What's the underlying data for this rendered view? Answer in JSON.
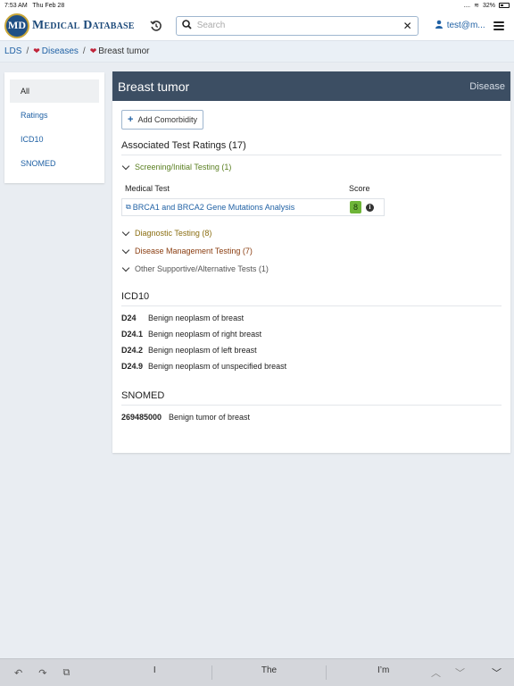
{
  "status_bar": {
    "time": "7:53 AM",
    "date": "Thu Feb 28",
    "signal": "....",
    "battery": "32%"
  },
  "navbar": {
    "logo_badge": "MD",
    "logo_text": "Medical Database",
    "search_placeholder": "Search",
    "user_label": "test@m..."
  },
  "breadcrumb": {
    "root": "LDS",
    "parent": "Diseases",
    "current": "Breast tumor"
  },
  "sidebar": {
    "items": [
      {
        "label": "All"
      },
      {
        "label": "Ratings"
      },
      {
        "label": "ICD10"
      },
      {
        "label": "SNOMED"
      }
    ]
  },
  "main": {
    "title": "Breast tumor",
    "type": "Disease",
    "add_button": "Add Comorbidity",
    "ratings_title": "Associated Test Ratings (17)",
    "groups": [
      {
        "label": "Screening/Initial Testing (1)",
        "color": "#5a7f20"
      },
      {
        "label": "Diagnostic Testing (8)",
        "color": "#8a6d10"
      },
      {
        "label": "Disease Management Testing (7)",
        "color": "#8a3d10"
      },
      {
        "label": "Other Supportive/Alternative Tests (1)",
        "color": "#555555"
      }
    ],
    "table": {
      "col_test": "Medical Test",
      "col_score": "Score",
      "rows": [
        {
          "test": "BRCA1 and BRCA2 Gene Mutations Analysis",
          "score": "8"
        }
      ]
    },
    "icd10": {
      "title": "ICD10",
      "codes": [
        {
          "code": "D24",
          "desc": "Benign neoplasm of breast"
        },
        {
          "code": "D24.1",
          "desc": "Benign neoplasm of right breast"
        },
        {
          "code": "D24.2",
          "desc": "Benign neoplasm of left breast"
        },
        {
          "code": "D24.9",
          "desc": "Benign neoplasm of unspecified breast"
        }
      ]
    },
    "snomed": {
      "title": "SNOMED",
      "codes": [
        {
          "code": "269485000",
          "desc": "Benign tumor of breast"
        }
      ]
    }
  },
  "keyboard": {
    "suggestions": [
      "I",
      "The",
      "I’m"
    ]
  },
  "colors": {
    "header_bg": "#3c4e63",
    "link": "#2162a5",
    "score_bg": "#6eb538"
  }
}
